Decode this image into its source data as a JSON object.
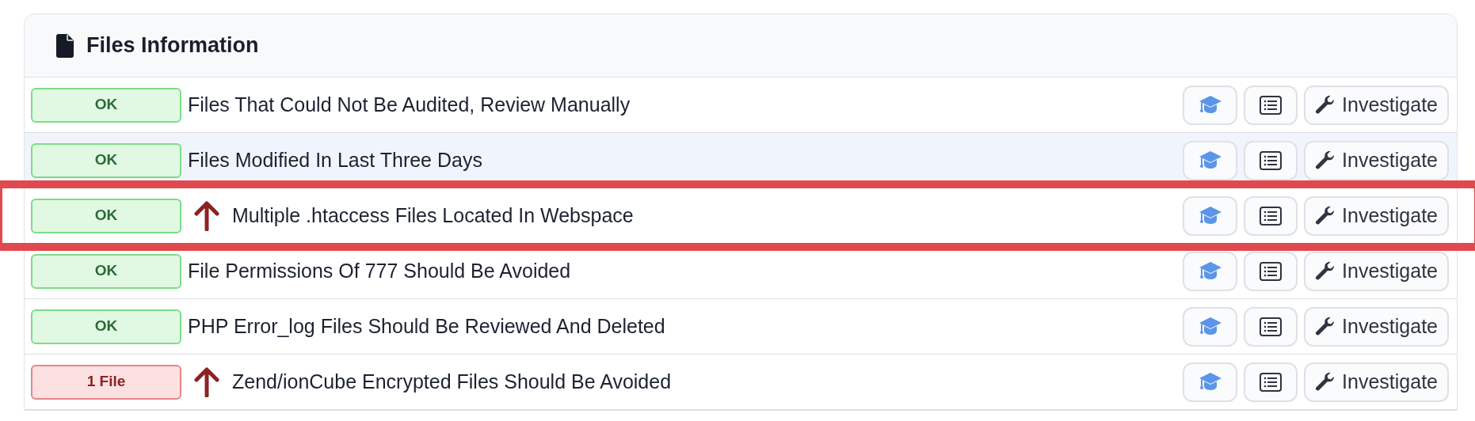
{
  "card": {
    "title": "Files Information"
  },
  "rows": [
    {
      "status": "OK",
      "kind": "ok",
      "raised": false,
      "highlighted": false,
      "flagged": false,
      "label": "Files That Could Not Be Audited, Review Manually",
      "action": "Investigate"
    },
    {
      "status": "OK",
      "kind": "ok",
      "raised": false,
      "highlighted": true,
      "flagged": false,
      "label": "Files Modified In Last Three Days",
      "action": "Investigate"
    },
    {
      "status": "OK",
      "kind": "ok",
      "raised": true,
      "highlighted": false,
      "flagged": true,
      "label": "Multiple .htaccess Files Located In Webspace",
      "action": "Investigate"
    },
    {
      "status": "OK",
      "kind": "ok",
      "raised": false,
      "highlighted": false,
      "flagged": false,
      "label": "File Permissions Of 777 Should Be Avoided",
      "action": "Investigate"
    },
    {
      "status": "OK",
      "kind": "ok",
      "raised": false,
      "highlighted": false,
      "flagged": false,
      "label": "PHP Error_log Files Should Be Reviewed And Deleted",
      "action": "Investigate"
    },
    {
      "status": "1 File",
      "kind": "fail",
      "raised": true,
      "highlighted": false,
      "flagged": false,
      "label": "Zend/ionCube Encrypted Files Should Be Avoided",
      "action": "Investigate"
    }
  ]
}
